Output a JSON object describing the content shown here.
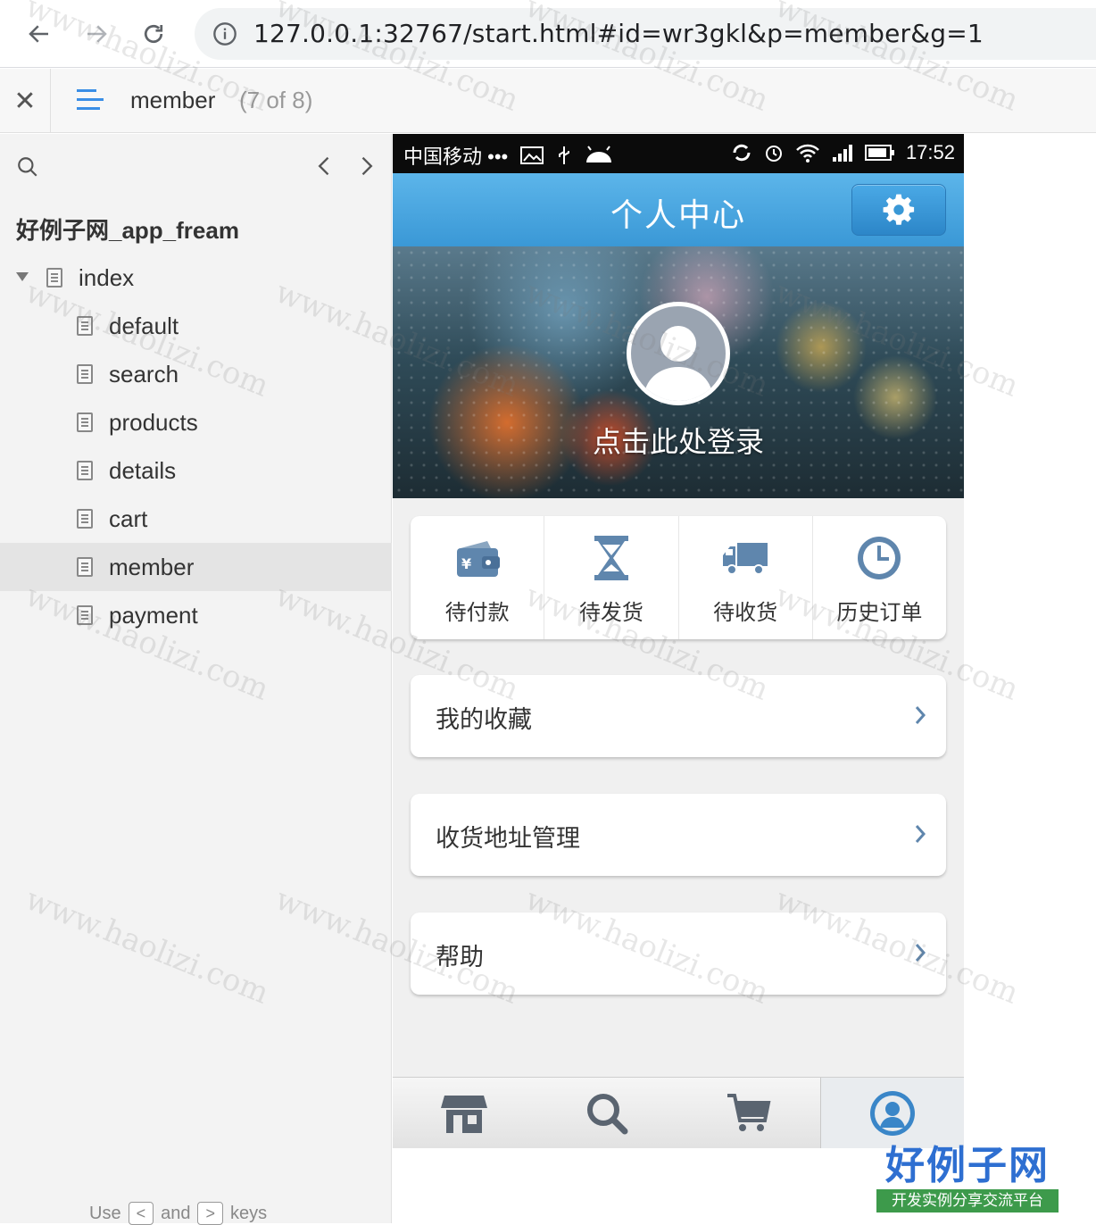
{
  "browser": {
    "url": "127.0.0.1:32767/start.html#id=wr3gkl&p=member&g=1"
  },
  "toolbar": {
    "page_name": "member",
    "page_count": "(7 of 8)"
  },
  "sidebar": {
    "project_title": "好例子网_app_fream",
    "tree": [
      {
        "label": "index",
        "level": 0,
        "expanded": true
      },
      {
        "label": "default",
        "level": 1
      },
      {
        "label": "search",
        "level": 1
      },
      {
        "label": "products",
        "level": 1
      },
      {
        "label": "details",
        "level": 1
      },
      {
        "label": "cart",
        "level": 1
      },
      {
        "label": "member",
        "level": 1,
        "active": true
      },
      {
        "label": "payment",
        "level": 1
      }
    ],
    "hint": {
      "use": "Use",
      "prev_key": "<",
      "and": "and",
      "next_key": ">",
      "keys": "keys"
    }
  },
  "phone": {
    "status": {
      "carrier": "中国移动 •••",
      "time": "17:52"
    },
    "header_title": "个人中心",
    "login_text": "点击此处登录",
    "orders": [
      {
        "label": "待付款",
        "icon": "wallet-icon"
      },
      {
        "label": "待发货",
        "icon": "hourglass-icon"
      },
      {
        "label": "待收货",
        "icon": "truck-icon"
      },
      {
        "label": "历史订单",
        "icon": "clock-icon"
      }
    ],
    "menu": [
      {
        "label": "我的收藏"
      },
      {
        "label": "收货地址管理"
      },
      {
        "label": "帮助"
      }
    ],
    "tabs": [
      {
        "icon": "store-icon"
      },
      {
        "icon": "search-icon"
      },
      {
        "icon": "cart-icon"
      },
      {
        "icon": "user-icon",
        "active": true
      }
    ],
    "accent": "#3a98d6"
  },
  "watermark": "www.haolizi.com",
  "logo": {
    "main": "好例子网",
    "sub": "开发实例分享交流平台"
  }
}
